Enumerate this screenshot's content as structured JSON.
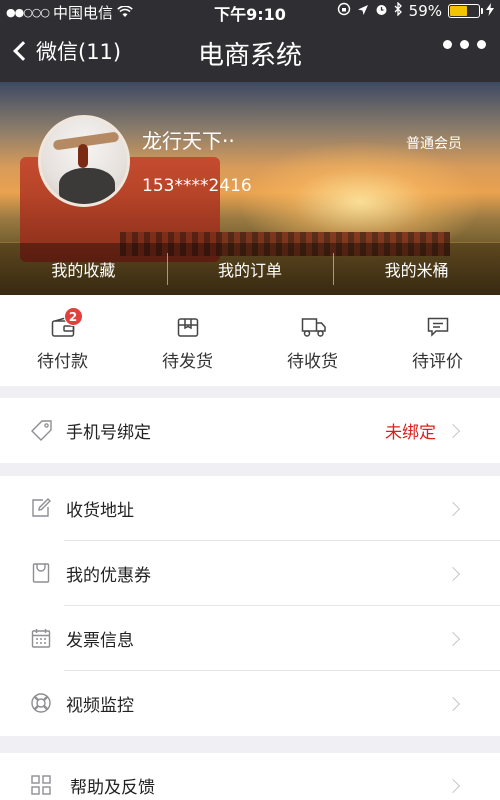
{
  "status_bar": {
    "signal": "●●○○○",
    "carrier": "中国电信",
    "time": "下午9:10",
    "battery": "59%",
    "battery_level": 0.59,
    "battery_color": "#f5c400"
  },
  "navbar": {
    "back_label": "微信(11)",
    "title": "电商系统",
    "more_icon": "more-dots-icon"
  },
  "profile": {
    "username": "龙行天下··",
    "member_level": "普通会员",
    "phone": "153****2416"
  },
  "banner_tabs": [
    {
      "label": "我的收藏"
    },
    {
      "label": "我的订单"
    },
    {
      "label": "我的米桶"
    }
  ],
  "order_status": [
    {
      "label": "待付款",
      "icon": "wallet-icon",
      "badge": "2"
    },
    {
      "label": "待发货",
      "icon": "package-icon"
    },
    {
      "label": "待收货",
      "icon": "truck-icon"
    },
    {
      "label": "待评价",
      "icon": "comment-icon"
    }
  ],
  "bind_phone": {
    "label": "手机号绑定",
    "value": "未绑定",
    "value_color": "#d9221a",
    "icon": "tag-icon"
  },
  "menu": [
    {
      "label": "收货地址",
      "icon": "edit-icon"
    },
    {
      "label": "我的优惠券",
      "icon": "bag-icon"
    },
    {
      "label": "发票信息",
      "icon": "calendar-icon"
    },
    {
      "label": "视频监控",
      "icon": "lifebuoy-icon"
    }
  ],
  "help": {
    "label": "帮助及反馈",
    "icon": "grid-icon"
  },
  "arrow_glyph": ">",
  "colors": {
    "navbar": "#2f2f33",
    "badge": "#e2403a",
    "accent_red": "#d9221a"
  }
}
